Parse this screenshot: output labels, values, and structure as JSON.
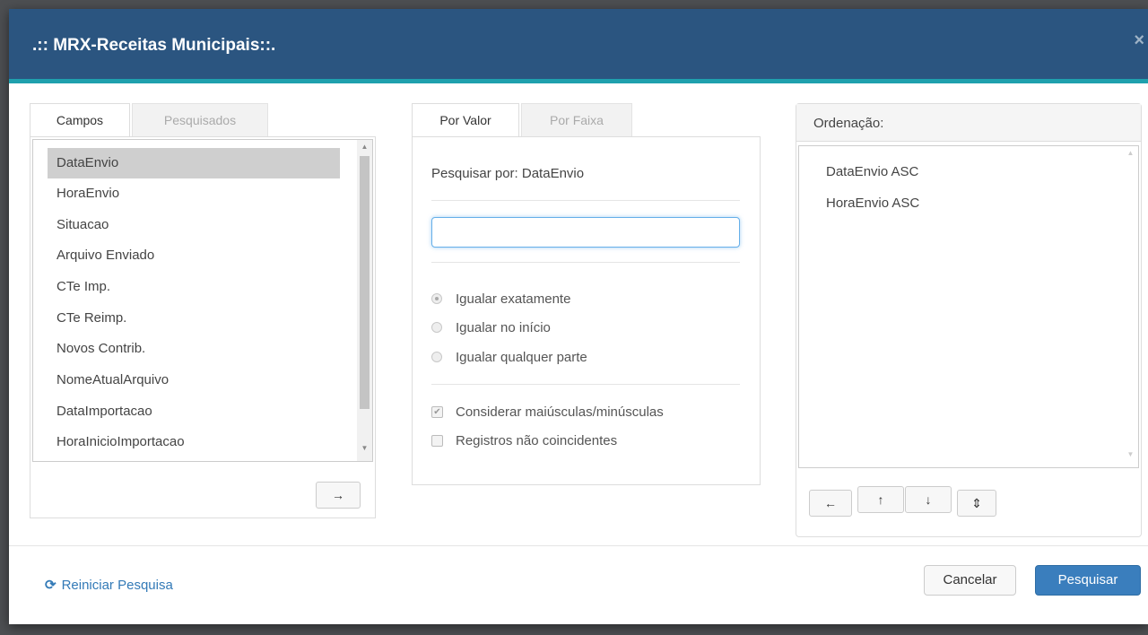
{
  "dialog": {
    "title": ".:: MRX-Receitas Municipais::.",
    "close_glyph": "×"
  },
  "fields_panel": {
    "tabs": [
      {
        "label": "Campos",
        "active": true
      },
      {
        "label": "Pesquisados",
        "active": false
      }
    ],
    "items": [
      "DataEnvio",
      "HoraEnvio",
      "Situacao",
      "Arquivo Enviado",
      "CTe Imp.",
      "CTe Reimp.",
      "Novos Contrib.",
      "NomeAtualArquivo",
      "DataImportacao",
      "HoraInicioImportacao"
    ],
    "selected_item": "DataEnvio",
    "add_button_glyph": "→"
  },
  "search_panel": {
    "tabs": [
      {
        "label": "Por Valor",
        "active": true
      },
      {
        "label": "Por Faixa",
        "active": false
      }
    ],
    "search_label": "Pesquisar por: DataEnvio",
    "input_value": "",
    "match_options": [
      {
        "label": "Igualar exatamente",
        "checked": true
      },
      {
        "label": "Igualar no início",
        "checked": false
      },
      {
        "label": "Igualar qualquer parte",
        "checked": false
      }
    ],
    "checkboxes": [
      {
        "label": "Considerar maiúsculas/minúsculas",
        "checked": true
      },
      {
        "label": "Registros não coincidentes",
        "checked": false
      }
    ]
  },
  "order_panel": {
    "heading": "Ordenação:",
    "items": [
      "DataEnvio ASC",
      "HoraEnvio ASC"
    ],
    "buttons": {
      "remove": "←",
      "up": "↑",
      "down": "↓",
      "toggle": "⇕"
    }
  },
  "footer": {
    "reset_icon": "refresh-icon",
    "reset_label": "Reiniciar Pesquisa",
    "cancel_label": "Cancelar",
    "search_label": "Pesquisar"
  },
  "colors": {
    "header": "#2b5580",
    "header_border": "#1fa0ad",
    "primary": "#3a7ebd",
    "link": "#337ab7"
  }
}
